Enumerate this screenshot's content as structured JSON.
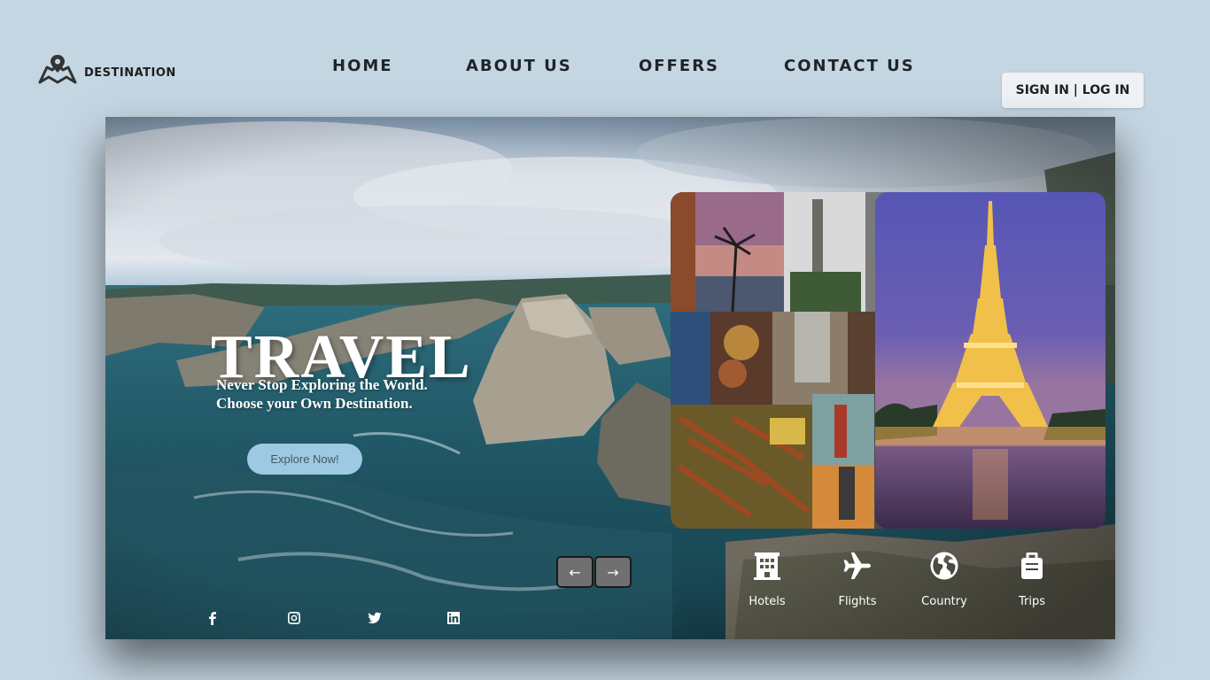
{
  "brand": {
    "name": "DESTINATION",
    "icon": "map-pin-icon"
  },
  "nav": {
    "items": [
      {
        "label": "HOME"
      },
      {
        "label": "ABOUT US"
      },
      {
        "label": "OFFERS"
      },
      {
        "label": "CONTACT US"
      }
    ]
  },
  "auth": {
    "label": "SIGN IN | LOG IN"
  },
  "hero": {
    "title": "TRAVEL",
    "tagline_line1": "Never Stop Exploring the World.",
    "tagline_line2": "Choose your Own Destination.",
    "cta_label": "Explore Now!",
    "prev_icon": "←",
    "next_icon": "→"
  },
  "social": [
    {
      "icon": "facebook-icon"
    },
    {
      "icon": "instagram-icon"
    },
    {
      "icon": "twitter-icon"
    },
    {
      "icon": "linkedin-icon"
    }
  ],
  "features": [
    {
      "label": "Hotels",
      "icon": "hotel-icon"
    },
    {
      "label": "Flights",
      "icon": "plane-icon"
    },
    {
      "label": "Country",
      "icon": "globe-icon"
    },
    {
      "label": "Trips",
      "icon": "luggage-icon"
    }
  ],
  "colors": {
    "page_bg": "#c5d6e3",
    "cta_bg": "#9ec9e2",
    "nav_text": "#1e2428"
  }
}
